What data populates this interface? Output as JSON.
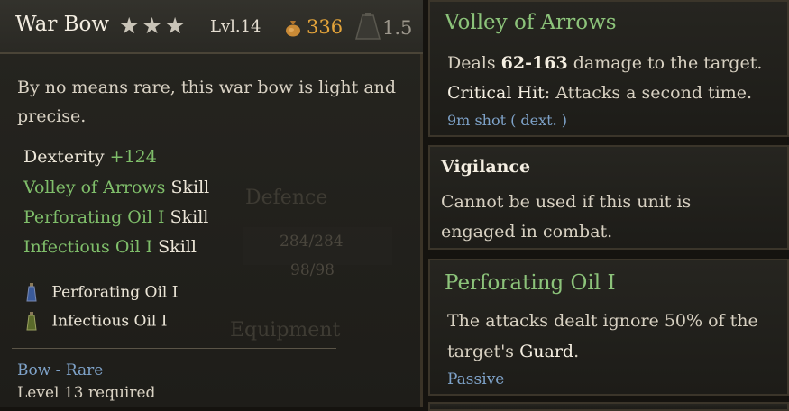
{
  "item": {
    "name": "War Bow",
    "stars": "★★★",
    "level": "Lvl.14",
    "price": "336",
    "weight": "1.5",
    "description": "By no means rare, this war bow is light and precise.",
    "attribute": {
      "name": "Dexterity",
      "value": "+124"
    },
    "skills": [
      {
        "name": "Volley of Arrows",
        "suffix": "Skill"
      },
      {
        "name": "Perforating Oil I",
        "suffix": "Skill"
      },
      {
        "name": "Infectious Oil I",
        "suffix": "Skill"
      }
    ],
    "oils": [
      "Perforating Oil I",
      "Infectious Oil I"
    ],
    "rarity": "Bow - Rare",
    "requirement": "Level 13 required"
  },
  "background_ghost": {
    "defence": "Defence",
    "hp": "284/284",
    "armor": "98/98",
    "equipment": "Equipment"
  },
  "tooltips": {
    "volley": {
      "title": "Volley of Arrows",
      "line1_pre": "Deals ",
      "line1_bold": "62-163",
      "line1_post": " damage to the target.",
      "line2_bold": "Critical Hit",
      "line2_post": ": Attacks a second time.",
      "meta": "9m shot ( dext. )"
    },
    "vigilance": {
      "title": "Vigilance",
      "line1": "Cannot be used if this unit is",
      "line2": "engaged in combat."
    },
    "perforating": {
      "title": "Perforating Oil I",
      "line1": "The attacks dealt ignore 50% of the",
      "line2_pre": "target's ",
      "line2_bold": "Guard",
      "line2_post": ".",
      "meta": "Passive"
    }
  },
  "colors": {
    "green": "#7fbe6a",
    "gold": "#e4a43a",
    "blue": "#7ea2c8"
  }
}
